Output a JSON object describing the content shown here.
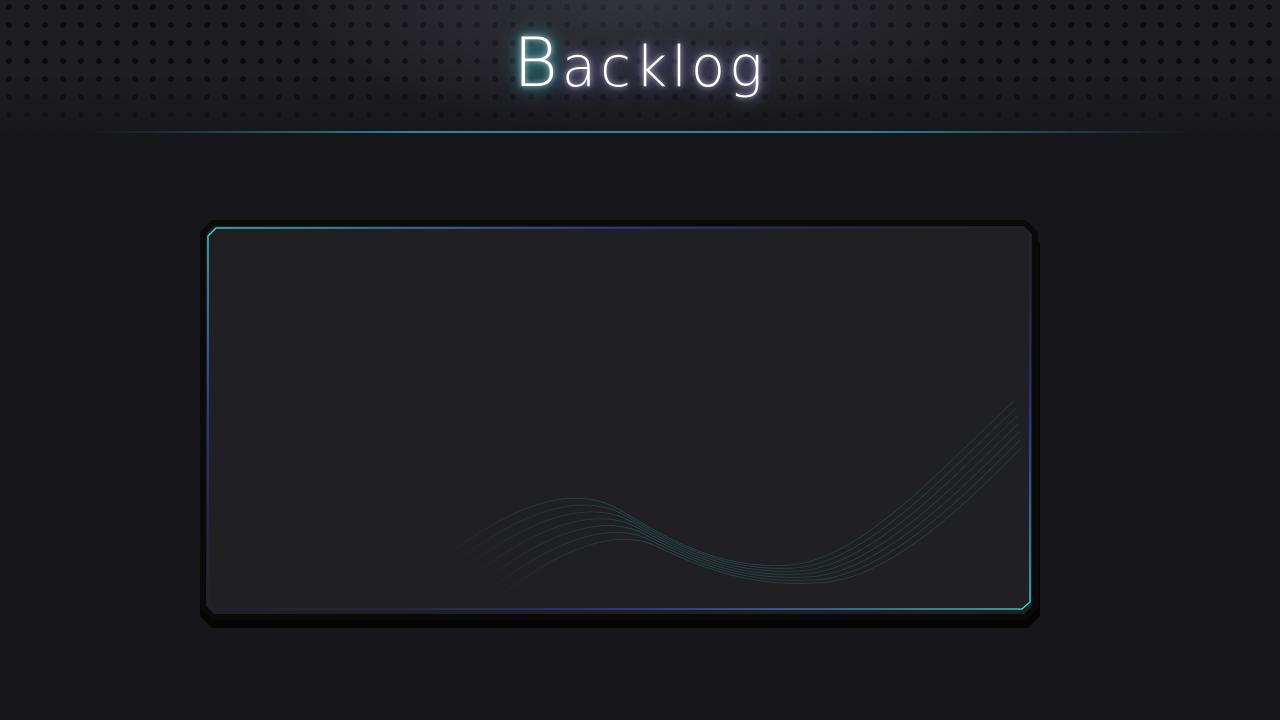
{
  "screen": {
    "title": "Backlog",
    "title_first_letter": "B",
    "title_rest": "acklog"
  },
  "backlog": {
    "entries": []
  },
  "colors": {
    "background": "#17171b",
    "panel": "#202024",
    "accent_cyan": "#3fe0dc",
    "accent_blue": "#3a3fd8",
    "accent_pink": "#e45ac8"
  }
}
